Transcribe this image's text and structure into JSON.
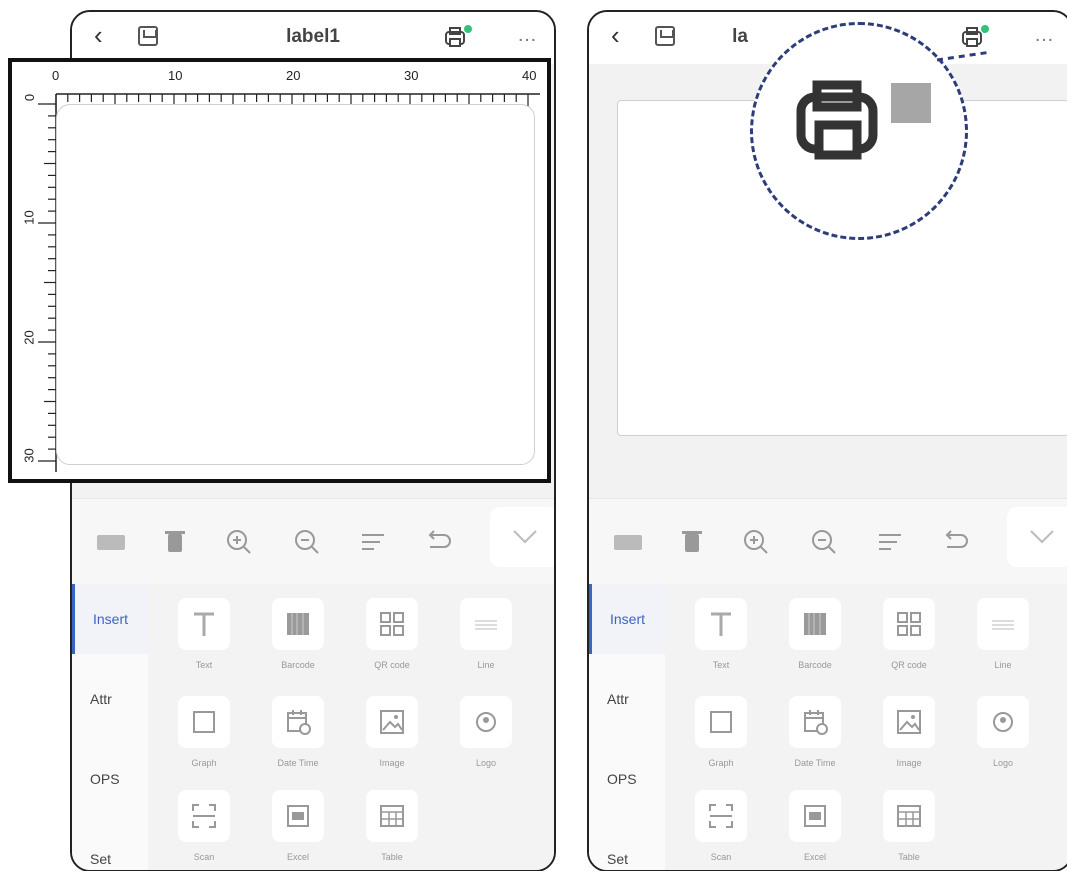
{
  "title": "label1",
  "title_partial": "la",
  "colors": {
    "accent": "#3b63c4",
    "status_dot": "#33c27a",
    "callout": "#2d3d7a"
  },
  "ruler": {
    "h_ticks": [
      "0",
      "10",
      "20",
      "30",
      "40"
    ],
    "v_ticks": [
      "0",
      "10",
      "20",
      "30"
    ]
  },
  "toolbar_icons": [
    "keyboard-icon",
    "delete-icon",
    "zoom-in-icon",
    "zoom-out-icon",
    "align-icon",
    "undo-icon",
    "collapse-icon"
  ],
  "sidebar": [
    {
      "label": "Insert",
      "active": true
    },
    {
      "label": "Attr",
      "active": false
    },
    {
      "label": "OPS",
      "active": false
    },
    {
      "label": "Set",
      "active": false
    }
  ],
  "insert_items": [
    {
      "label": "Text",
      "icon": "text-icon"
    },
    {
      "label": "Barcode",
      "icon": "barcode-icon"
    },
    {
      "label": "QR code",
      "icon": "qrcode-icon"
    },
    {
      "label": "Line",
      "icon": "line-icon"
    },
    {
      "label": "Graph",
      "icon": "graph-icon"
    },
    {
      "label": "Date Time",
      "icon": "date-time-icon"
    },
    {
      "label": "Image",
      "icon": "image-icon"
    },
    {
      "label": "Logo",
      "icon": "logo-icon"
    },
    {
      "label": "Scan",
      "icon": "scan-icon"
    },
    {
      "label": "Excel",
      "icon": "excel-icon"
    },
    {
      "label": "Table",
      "icon": "table-icon"
    }
  ]
}
